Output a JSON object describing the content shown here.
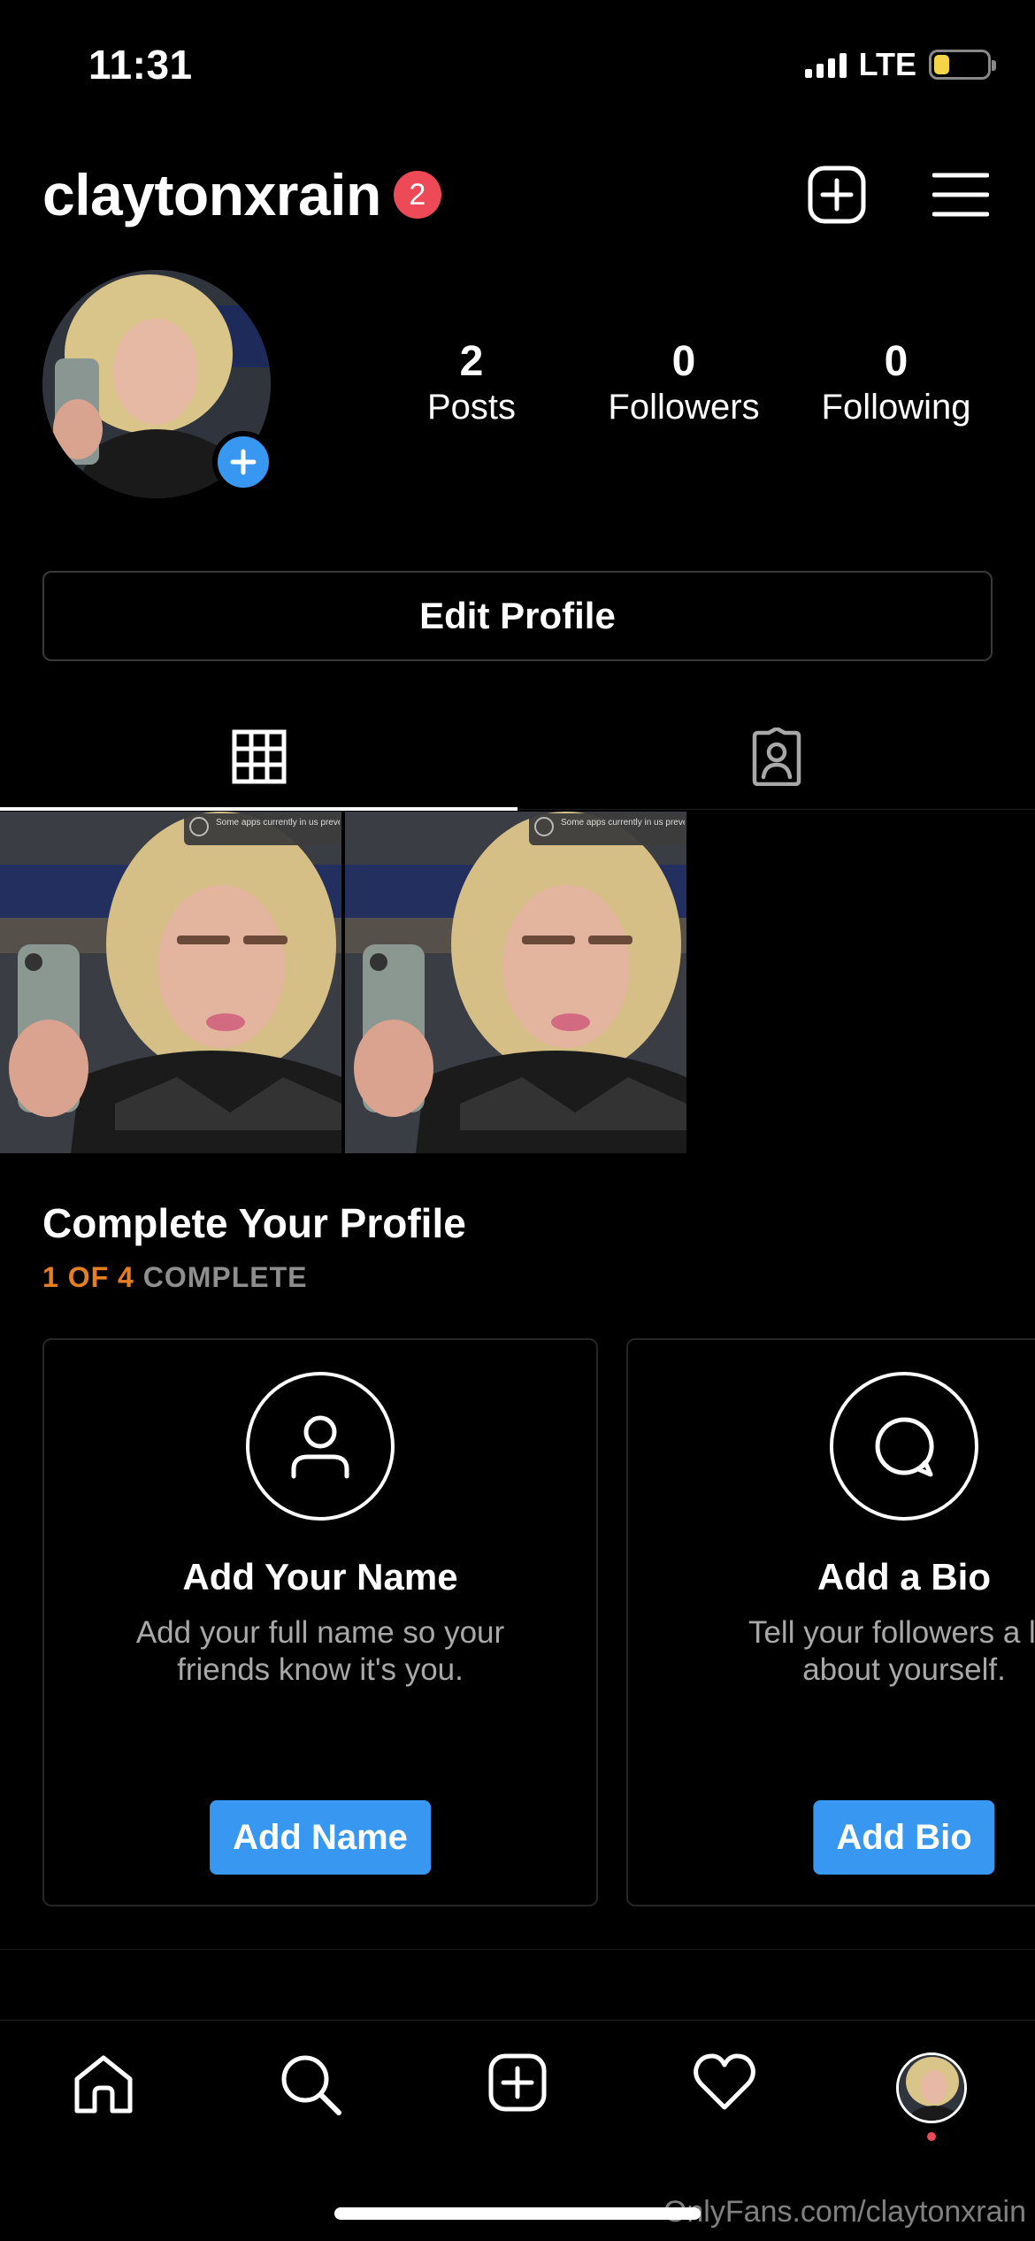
{
  "status_bar": {
    "time": "11:31",
    "network": "LTE",
    "battery_color": "#f5d547"
  },
  "header": {
    "username": "claytonxrain",
    "notification_count": "2"
  },
  "profile": {
    "stats": [
      {
        "value": "2",
        "label": "Posts"
      },
      {
        "value": "0",
        "label": "Followers"
      },
      {
        "value": "0",
        "label": "Following"
      }
    ],
    "edit_label": "Edit Profile"
  },
  "tabs": [
    {
      "icon": "grid-icon",
      "active": true
    },
    {
      "icon": "tagged-icon",
      "active": false
    }
  ],
  "posts": [
    {
      "notice": "Some apps currently in us preventing automatic upd"
    },
    {
      "notice": "Some apps currently in us preventing automatic upd"
    }
  ],
  "complete_profile": {
    "title": "Complete Your Profile",
    "progress_done": "1 OF 4",
    "progress_rest": "COMPLETE",
    "cards": [
      {
        "icon": "person-icon",
        "title": "Add Your Name",
        "desc1": "Add your full name so your",
        "desc2": "friends know it's you.",
        "button": "Add Name"
      },
      {
        "icon": "speech-bubble-icon",
        "title": "Add a Bio",
        "desc1": "Tell your followers a litt",
        "desc2": "about yourself.",
        "button": "Add Bio"
      }
    ]
  },
  "nav": [
    "home-icon",
    "search-icon",
    "new-post-icon",
    "heart-icon",
    "profile-avatar"
  ],
  "colors": {
    "accent": "#3897f0",
    "badge": "#ed4956",
    "progress": "#e67e22"
  },
  "watermark": "OnlyFans.com/claytonxrain"
}
